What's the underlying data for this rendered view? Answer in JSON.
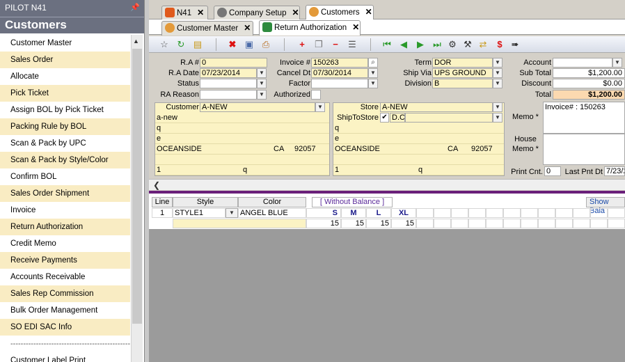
{
  "app": {
    "panel_title": "PILOT N41",
    "section": "Customers"
  },
  "sidebar": {
    "items": [
      "Customer Master",
      "Sales Order",
      "Allocate",
      "Pick Ticket",
      "Assign BOL by Pick Ticket",
      "Packing Rule by BOL",
      "Scan & Pack by UPC",
      "Scan & Pack by Style/Color",
      "Confirm BOL",
      "Sales Order Shipment",
      "Invoice",
      "Return Authorization",
      "Credit Memo",
      "Receive Payments",
      "Accounts Receivable",
      "Sales Rep Commission",
      "Bulk Order Management",
      "SO EDI SAC Info"
    ],
    "separator": "------------------------------------------------",
    "after": "Customer Label Print"
  },
  "tabs": [
    {
      "label": "N41",
      "icon": "n41-logo-icon"
    },
    {
      "label": "Company Setup",
      "icon": "gear-icon"
    },
    {
      "label": "Customers",
      "icon": "customers-icon"
    }
  ],
  "subtabs": [
    {
      "label": "Customer Master"
    },
    {
      "label": "Return Authorization"
    }
  ],
  "form": {
    "ra_no_label": "R.A #",
    "ra_no": "0",
    "ra_date_label": "R.A Date",
    "ra_date": "07/23/2014",
    "status_label": "Status",
    "status": "",
    "ra_reason_label": "RA Reason",
    "ra_reason": "",
    "invoice_label": "Invoice #",
    "invoice": "150263",
    "cancel_label": "Cancel Dt",
    "cancel": "07/30/2014",
    "factor_label": "Factor",
    "factor": "",
    "authorized_label": "Authorized",
    "term_label": "Term",
    "term": "DOR",
    "shipvia_label": "Ship Via",
    "shipvia": "UPS GROUND",
    "division_label": "Division",
    "division": "B",
    "account_label": "Account",
    "account": "",
    "subtotal_label": "Sub Total",
    "subtotal": "$1,200.00",
    "discount_label": "Discount",
    "discount": "$0.00",
    "total_label": "Total",
    "total": "$1,200.00",
    "customer_label": "Customer",
    "customer": "A-NEW",
    "cust_name": "a-new",
    "cust_addr1": "q",
    "cust_addr2": "e",
    "cust_city": "OCEANSIDE",
    "cust_state": "CA",
    "cust_zip": "92057",
    "cust_phone": "1",
    "cust_phone2": "q",
    "store_label": "Store",
    "store": "A-NEW",
    "shiptostore_label": "ShipToStore",
    "shiptostore_val": "D.C",
    "store_addr1": "q",
    "store_addr2": "e",
    "store_city": "OCEANSIDE",
    "store_state": "CA",
    "store_zip": "92057",
    "store_phone": "1",
    "store_phone2": "q",
    "memo_label": "Memo *",
    "memo": "Invoice# : 150263",
    "housememo_label": "House Memo *",
    "housememo": "",
    "printcnt_label": "Print Cnt.",
    "printcnt": "0",
    "lastpnt_label": "Last Pnt Dt",
    "lastpnt": "7/23/2"
  },
  "grid": {
    "headers": {
      "line": "Line",
      "style": "Style",
      "color": "Color"
    },
    "without_balance": "[ Without Balance ]",
    "show_balance": "Show Bala",
    "sizes": [
      "S",
      "M",
      "L",
      "XL"
    ],
    "row": {
      "line": "1",
      "style": "STYLE1",
      "color": "ANGEL BLUE",
      "qty": [
        "15",
        "15",
        "15",
        "15"
      ]
    }
  }
}
